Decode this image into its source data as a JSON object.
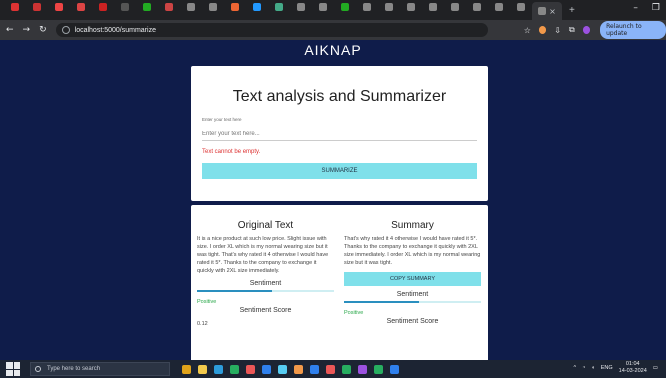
{
  "browser": {
    "url": "localhost:5000/summarize",
    "relaunch_label": "Relaunch to update",
    "minimize": "–",
    "close": "×",
    "new_tab": "+",
    "tab_icons": [
      "circle",
      "circle",
      "flag",
      "pin",
      "pin",
      "flag",
      "github",
      "circle",
      "mail",
      "doc",
      "doc",
      "doc",
      "web",
      "web",
      "web",
      "web",
      "web",
      "web",
      "web",
      "github",
      "web",
      "web",
      "doc",
      "web",
      "active"
    ],
    "tab_colors": [
      "#d33",
      "#c33",
      "#e44",
      "#d44",
      "#c22",
      "#555",
      "#2a2",
      "#c44",
      "#888",
      "#888",
      "#e63",
      "#29f",
      "#4a8",
      "#888",
      "#888",
      "#2a2",
      "#888",
      "#888",
      "#888",
      "#888",
      "#888",
      "#888",
      "#888",
      "#888",
      "#888"
    ]
  },
  "app": {
    "title": "AIKNAP"
  },
  "form": {
    "heading": "Text analysis and Summarizer",
    "input_label": "Enter your text here",
    "input_placeholder": "Enter your text here...",
    "error": "Text cannot be empty.",
    "submit_label": "SUMMARIZE"
  },
  "original": {
    "heading": "Original Text",
    "text": "It is a nice product at such low price. Slight issue with size. I order XL which is my normal wearing size but it was tight. That's why rated it 4 otherwise I would have rated it 5*. Thanks to the company to exchange it quickly with 2XL size immediately.",
    "sentiment_label": "Sentiment",
    "sentiment_value": "Positive",
    "sentiment_fill": 0.55,
    "score_label": "Sentiment Score",
    "score_value": "0.12"
  },
  "summary": {
    "heading": "Summary",
    "text": "That's why rated it 4 otherwise I would have rated it 5*. Thanks to the company to exchange it quickly with 2XL size immediately. I order XL which is my normal wearing size but it was tight.",
    "copy_label": "COPY SUMMARY",
    "sentiment_label": "Sentiment",
    "sentiment_value": "Positive",
    "sentiment_fill": 0.55,
    "score_label": "Sentiment Score"
  },
  "taskbar": {
    "search_placeholder": "Type here to search",
    "lang": "ENG",
    "time": "01:04",
    "date": "14-03-2024",
    "icon_colors": [
      "#e0a31a",
      "#f2c94c",
      "#2d9cdb",
      "#27ae60",
      "#eb5757",
      "#2f80ed",
      "#56ccf2",
      "#f2994a",
      "#2f80ed",
      "#eb5757",
      "#27ae60",
      "#9b51e0",
      "#27ae60",
      "#2f80ed"
    ]
  }
}
